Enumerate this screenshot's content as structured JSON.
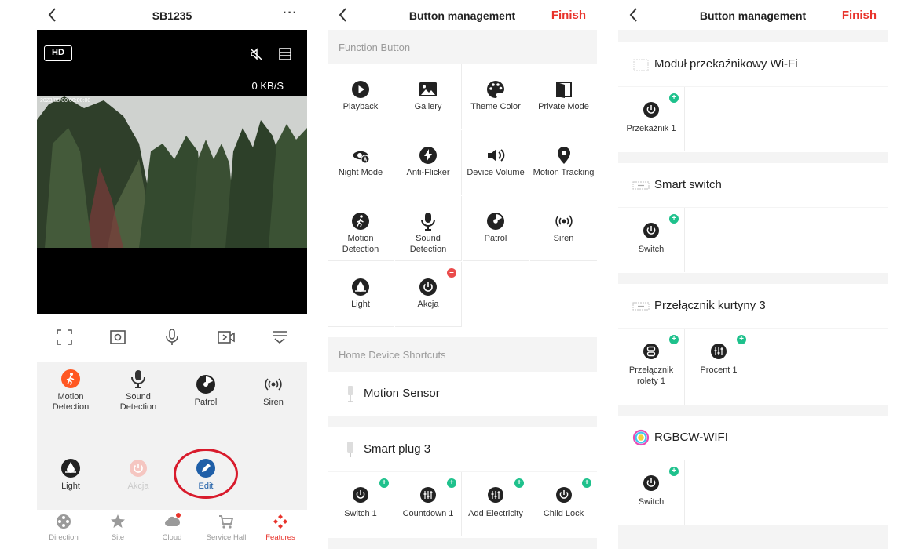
{
  "colors": {
    "accent": "#e8332b",
    "badge_add": "#1ec18c",
    "badge_remove": "#ea4b4b",
    "edit_blue": "#1f5fa8",
    "motion_orange": "#ff5722"
  },
  "screen1": {
    "title": "SB1235",
    "more_label": "···",
    "video": {
      "quality": "HD",
      "rate": "0 KB/S",
      "osd": "2023/00/00 00:00:00"
    },
    "controls": [
      "fullscreen-icon",
      "snapshot-icon",
      "microphone-icon",
      "record-icon",
      "collapse-icon"
    ],
    "features": [
      {
        "label": "Motion\nDetection",
        "icon": "motion-detection-icon"
      },
      {
        "label": "Sound\nDetection",
        "icon": "sound-detection-icon"
      },
      {
        "label": "Patrol",
        "icon": "patrol-icon"
      },
      {
        "label": "Siren",
        "icon": "siren-icon"
      },
      {
        "label": "Light",
        "icon": "light-icon"
      },
      {
        "label": "Akcja",
        "icon": "power-icon"
      },
      {
        "label": "Edit",
        "icon": "edit-icon"
      }
    ],
    "tabs": [
      {
        "label": "Direction",
        "icon": "direction-icon"
      },
      {
        "label": "Site",
        "icon": "star-icon"
      },
      {
        "label": "Cloud",
        "icon": "cloud-icon"
      },
      {
        "label": "Service Hall",
        "icon": "cart-icon"
      },
      {
        "label": "Features",
        "icon": "features-icon",
        "active": true
      }
    ]
  },
  "screen2": {
    "title": "Button management",
    "finish": "Finish",
    "function_header": "Function Button",
    "functions": [
      {
        "label": "Playback",
        "icon": "playback-icon"
      },
      {
        "label": "Gallery",
        "icon": "gallery-icon"
      },
      {
        "label": "Theme Color",
        "icon": "palette-icon"
      },
      {
        "label": "Private Mode",
        "icon": "private-mode-icon"
      },
      {
        "label": "Night Mode",
        "icon": "night-mode-icon"
      },
      {
        "label": "Anti-Flicker",
        "icon": "flash-icon"
      },
      {
        "label": "Device Volume",
        "icon": "volume-icon"
      },
      {
        "label": "Motion Tracking",
        "icon": "location-pin-icon"
      },
      {
        "label": "Motion\nDetection",
        "icon": "motion-detection-icon"
      },
      {
        "label": "Sound\nDetection",
        "icon": "sound-detection-icon"
      },
      {
        "label": "Patrol",
        "icon": "patrol-icon"
      },
      {
        "label": "Siren",
        "icon": "siren-icon"
      },
      {
        "label": "Light",
        "icon": "light-icon"
      },
      {
        "label": "Akcja",
        "icon": "power-icon"
      }
    ],
    "shortcuts_header": "Home Device Shortcuts",
    "devices": [
      {
        "name": "Motion Sensor",
        "icon": "motion-sensor-icon"
      },
      {
        "name": "Smart plug 3",
        "icon": "smart-plug-icon"
      }
    ],
    "plug_buttons": [
      {
        "label": "Switch 1",
        "icon": "power-icon"
      },
      {
        "label": "Countdown 1",
        "icon": "tune-icon"
      },
      {
        "label": "Add Electricity",
        "icon": "tune-icon"
      },
      {
        "label": "Child Lock",
        "icon": "power-icon"
      }
    ]
  },
  "screen3": {
    "title": "Button management",
    "finish": "Finish",
    "devices": [
      {
        "name": "Moduł przekaźnikowy Wi-Fi",
        "icon": "relay-module-icon",
        "buttons": [
          {
            "label": "Przekaźnik 1",
            "icon": "power-icon"
          }
        ]
      },
      {
        "name": "Smart switch",
        "icon": "switch-module-icon",
        "buttons": [
          {
            "label": "Switch",
            "icon": "power-icon"
          }
        ]
      },
      {
        "name": "Przełącznik kurtyny 3",
        "icon": "curtain-switch-icon",
        "buttons": [
          {
            "label": "Przełącznik\nrolety 1",
            "icon": "curtain-icon"
          },
          {
            "label": "Procent 1",
            "icon": "tune-icon"
          }
        ]
      },
      {
        "name": "RGBCW-WIFI",
        "icon": "rgb-bulb-icon",
        "buttons": [
          {
            "label": "Switch",
            "icon": "power-icon"
          }
        ]
      }
    ]
  }
}
